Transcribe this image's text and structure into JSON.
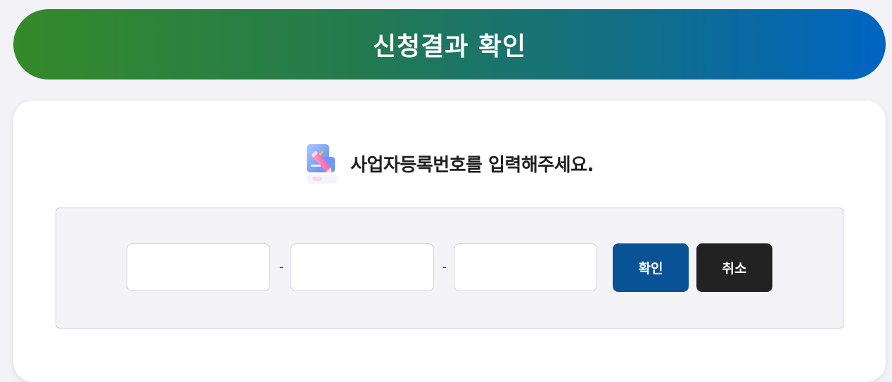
{
  "banner": {
    "title": "신청결과 확인",
    "gradient_start": "#358a2a",
    "gradient_end": "#0064c3"
  },
  "instruction": {
    "icon": "pencil-checklist-icon",
    "text": "사업자등록번호를 입력해주세요."
  },
  "form": {
    "fields": [
      {
        "value": "",
        "placeholder": ""
      },
      {
        "value": "",
        "placeholder": ""
      },
      {
        "value": "",
        "placeholder": ""
      }
    ],
    "separator": "-",
    "confirm_label": "확인",
    "cancel_label": "취소",
    "confirm_color": "#0a5296",
    "cancel_color": "#222222"
  }
}
